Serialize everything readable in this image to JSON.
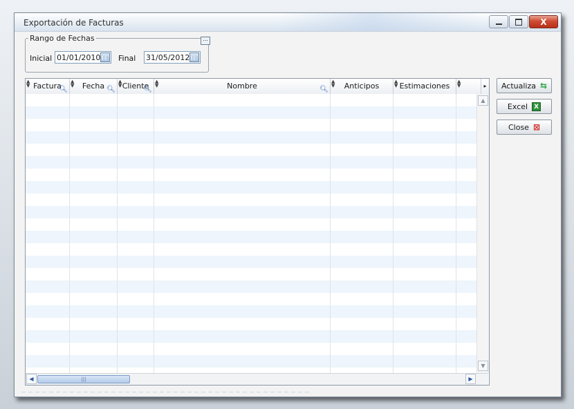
{
  "window": {
    "title": "Exportación de Facturas",
    "controls": {
      "minimize": "minimize",
      "maximize": "maximize",
      "close": "X"
    }
  },
  "date_range": {
    "legend": "Rango de Fechas",
    "ellipsis": "...",
    "initial_label": "Inicial",
    "initial_value": "01/01/2010",
    "final_label": "Final",
    "final_value": "31/05/2012"
  },
  "grid": {
    "columns": [
      {
        "label": "Factura",
        "filter": true
      },
      {
        "label": "Fecha",
        "filter": true
      },
      {
        "label": "Cliente",
        "filter": true
      },
      {
        "label": "Nombre",
        "filter": true
      },
      {
        "label": "Anticipos",
        "filter": false
      },
      {
        "label": "Estimaciones",
        "filter": false
      }
    ],
    "more_columns_icon": "▸",
    "rows": [],
    "hscroll_grip": "|||"
  },
  "actions": {
    "refresh_label": "Actualiza",
    "excel_label": "Excel",
    "excel_icon_text": "X",
    "close_label": "Close"
  },
  "icons": {
    "refresh": "refresh-icon",
    "excel": "excel-icon",
    "close": "close-x-icon",
    "filter": "magnifier-icon",
    "calendar": "calendar-icon"
  },
  "colors": {
    "row_alt": "#eef5fc",
    "close_button": "#cf4a32",
    "excel_green": "#2f8f3a",
    "refresh_green": "#33a64a"
  }
}
